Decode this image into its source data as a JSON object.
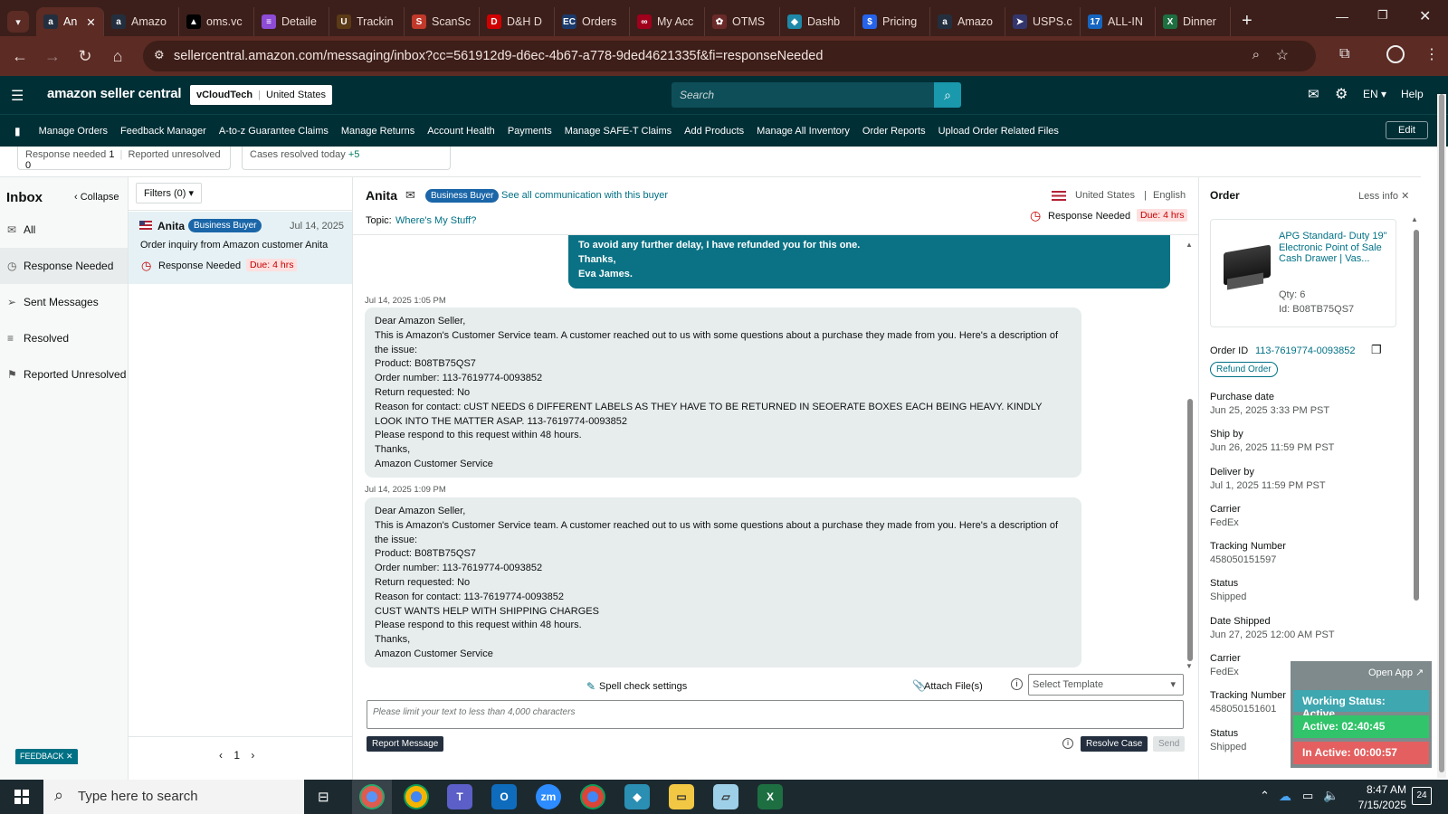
{
  "browser": {
    "tabs": [
      {
        "label": "An",
        "fav": "a",
        "color": "#232f3e"
      },
      {
        "label": "Amazo",
        "fav": "a",
        "color": "#232f3e"
      },
      {
        "label": "oms.vc",
        "fav": "▲",
        "color": "#000"
      },
      {
        "label": "Detaile",
        "fav": "≡",
        "color": "#8e4bd6"
      },
      {
        "label": "Trackin",
        "fav": "U",
        "color": "#5b3a17"
      },
      {
        "label": "ScanSc",
        "fav": "S",
        "color": "#c0392b"
      },
      {
        "label": "D&H D",
        "fav": "D",
        "color": "#d10000"
      },
      {
        "label": "Orders",
        "fav": "EC",
        "color": "#1a3a6b"
      },
      {
        "label": "My Acc",
        "fav": "∞",
        "color": "#a0001c"
      },
      {
        "label": "OTMS",
        "fav": "✿",
        "color": "#6b2a2a"
      },
      {
        "label": "Dashb",
        "fav": "◆",
        "color": "#1e88a8"
      },
      {
        "label": "Pricing",
        "fav": "$",
        "color": "#2563eb"
      },
      {
        "label": "Amazo",
        "fav": "a",
        "color": "#232f3e"
      },
      {
        "label": "USPS.c",
        "fav": "➤",
        "color": "#33366d"
      },
      {
        "label": "ALL-IN",
        "fav": "17",
        "color": "#1565c0"
      },
      {
        "label": "Dinner",
        "fav": "X",
        "color": "#1d6f42"
      }
    ],
    "url": "sellercentral.amazon.com/messaging/inbox?cc=561912d9-d6ec-4b67-a778-9ded4621335f&fi=responseNeeded"
  },
  "header": {
    "logo": "amazon seller central",
    "store": "vCloudTech",
    "marketplace": "United States",
    "search_placeholder": "Search",
    "language": "EN",
    "help": "Help"
  },
  "nav": {
    "items": [
      "Manage Orders",
      "Feedback Manager",
      "A-to-z Guarantee Claims",
      "Manage Returns",
      "Account Health",
      "Payments",
      "Manage SAFE-T Claims",
      "Add Products",
      "Manage All Inventory",
      "Order Reports",
      "Upload Order Related Files"
    ],
    "edit": "Edit"
  },
  "stats": {
    "response_needed_label": "Response needed",
    "response_needed_count": "1",
    "reported_unresolved_label": "Reported unresolved",
    "reported_unresolved_count": "0",
    "cases_resolved_label": "Cases resolved today",
    "cases_resolved_count": "+5"
  },
  "inbox": {
    "title": "Inbox",
    "collapse": "Collapse",
    "items": [
      "All",
      "Response Needed",
      "Sent Messages",
      "Resolved",
      "Reported Unresolved"
    ],
    "filters": "Filters (0)",
    "feedback": "FEEDBACK"
  },
  "thread": {
    "name": "Anita",
    "badge": "Business Buyer",
    "date": "Jul 14, 2025",
    "subject": "Order inquiry from Amazon customer Anita",
    "status": "Response Needed",
    "due": "Due: 4 hrs",
    "page": "1"
  },
  "conversation": {
    "buyer": "Anita",
    "badge": "Business Buyer",
    "see_all": "See all communication with this buyer",
    "country": "United States",
    "language": "English",
    "topic_label": "Topic:",
    "topic": "Where's My Stuff?",
    "status": "Response Needed",
    "due": "Due: 4 hrs",
    "seller_msg": [
      "To avoid any further delay, I have refunded you for this one.",
      "Thanks,",
      "Eva James."
    ],
    "msg1_time": "Jul 14, 2025 1:05 PM",
    "msg1": [
      "Dear Amazon Seller,",
      "This is Amazon's Customer Service team. A customer reached out to us with some questions about a purchase they made from you. Here's a description of the issue:",
      "Product: B08TB75QS7",
      "Order number: 113-7619774-0093852",
      "Return requested: No",
      "Reason for contact: cUST NEEDS 6 DIFFERENT LABELS AS THEY HAVE TO BE RETURNED IN SEOERATE BOXES EACH BEING HEAVY. KINDLY LOOK INTO THE MATTER ASAP. 113-7619774-0093852",
      "Please respond to this request within 48 hours.",
      "Thanks,",
      "Amazon Customer Service"
    ],
    "msg2_time": "Jul 14, 2025 1:09 PM",
    "msg2": [
      "Dear Amazon Seller,",
      "This is Amazon's Customer Service team. A customer reached out to us with some questions about a purchase they made from you. Here's a description of the issue:",
      "Product: B08TB75QS7",
      "Order number: 113-7619774-0093852",
      "Return requested: No",
      "Reason for contact: 113-7619774-0093852",
      "CUST WANTS HELP WITH SHIPPING CHARGES",
      "Please respond to this request within 48 hours.",
      "Thanks,",
      "Amazon Customer Service"
    ],
    "spell_check": "Spell check settings",
    "attach": "Attach File(s)",
    "template_placeholder": "Select Template",
    "reply_placeholder": "Please limit your text to less than 4,000 characters",
    "report": "Report Message",
    "resolve": "Resolve Case",
    "send": "Send"
  },
  "order": {
    "title": "Order",
    "less_info": "Less info",
    "product_title": "APG Standard- Duty 19\" Electronic Point of Sale Cash Drawer | Vas...",
    "qty": "Qty: 6",
    "id": "Id: B08TB75QS7",
    "order_id_label": "Order ID",
    "order_id": "113-7619774-0093852",
    "refund": "Refund Order",
    "fields": [
      {
        "label": "Purchase date",
        "value": "Jun 25, 2025 3:33 PM PST"
      },
      {
        "label": "Ship by",
        "value": "Jun 26, 2025 11:59 PM PST"
      },
      {
        "label": "Deliver by",
        "value": "Jul 1, 2025 11:59 PM PST"
      },
      {
        "label": "Carrier",
        "value": "FedEx"
      },
      {
        "label": "Tracking Number",
        "value": "458050151597"
      },
      {
        "label": "Status",
        "value": "Shipped"
      },
      {
        "label": "Date Shipped",
        "value": "Jun 27, 2025 12:00 AM PST"
      },
      {
        "label": "Carrier",
        "value": "FedEx"
      },
      {
        "label": "Tracking Number",
        "value": "458050151601"
      },
      {
        "label": "Status",
        "value": "Shipped"
      }
    ]
  },
  "widget": {
    "open_app": "Open App",
    "working": "Working Status: Active",
    "active": "Active: 02:40:45",
    "inactive": "In Active: 00:00:57"
  },
  "taskbar": {
    "search_placeholder": "Type here to search",
    "time": "8:47 AM",
    "date": "7/15/2025",
    "notifications": "24"
  }
}
